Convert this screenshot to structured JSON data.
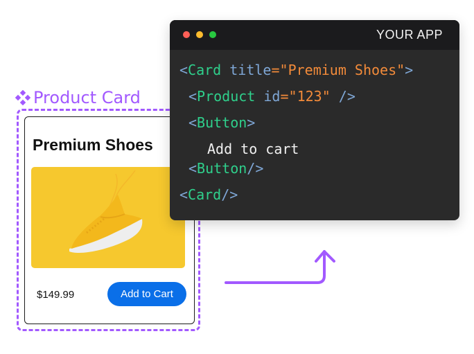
{
  "product_card_label": {
    "icon": "four-diamonds-icon",
    "text": "Product Card"
  },
  "card": {
    "title": "Premium Shoes",
    "image_alt": "yellow sneaker",
    "price": "$149.99",
    "button_label": "Add to Cart"
  },
  "code_window": {
    "title": "YOUR APP",
    "window_controls": [
      "close",
      "minimize",
      "maximize"
    ],
    "lines": {
      "l1": {
        "open": "<",
        "tag": "Card",
        "attr": "title",
        "eq": "=",
        "value": "\"Premium Shoes\"",
        "close": ">"
      },
      "l2": {
        "open": "<",
        "tag": "Product",
        "attr": "id",
        "eq": "=",
        "value": "\"123\"",
        "close": " />"
      },
      "l3": {
        "open": "<",
        "tag": "Button",
        "close": ">"
      },
      "l4": {
        "text": "Add to cart"
      },
      "l5": {
        "open": "<",
        "tag": "Button",
        "close": "/>"
      },
      "l6": {
        "open": "<",
        "tag": "Card",
        "close": "/>"
      }
    }
  },
  "colors": {
    "accent_purple": "#a259ff",
    "button_blue": "#0a6fe8",
    "image_yellow": "#f6c82e",
    "code_bg": "#2a2a2a",
    "tag_green": "#2fd08c",
    "string_orange": "#f38b3a",
    "attr_blue": "#7fa7d6"
  }
}
